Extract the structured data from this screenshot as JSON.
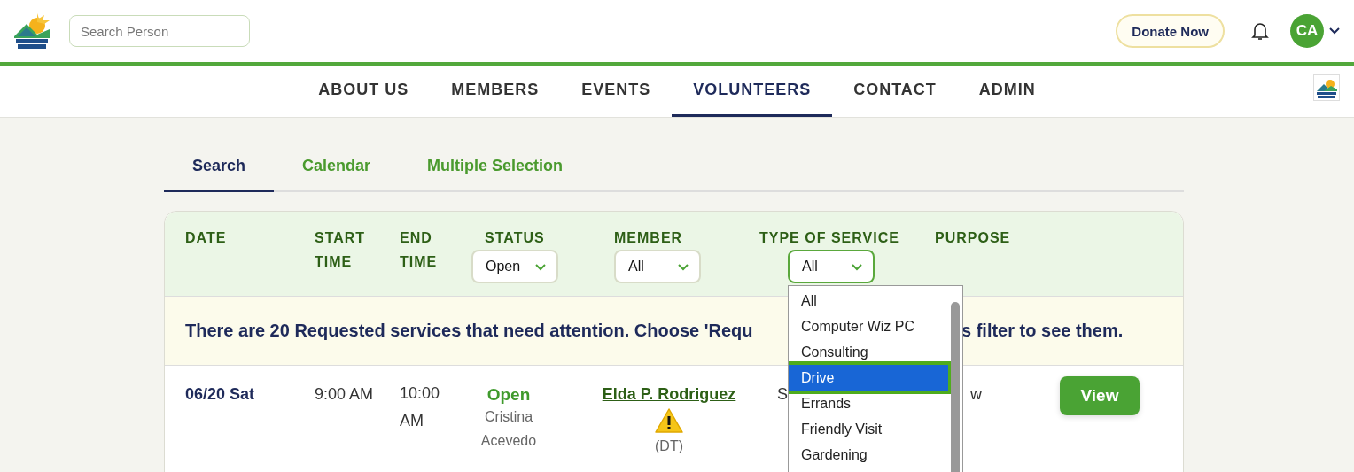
{
  "header": {
    "search": {
      "placeholder": "Search Person"
    },
    "donate": "Donate Now",
    "avatar": "CA"
  },
  "nav": [
    {
      "label": "ABOUT US",
      "selected": false
    },
    {
      "label": "MEMBERS",
      "selected": false
    },
    {
      "label": "EVENTS",
      "selected": false
    },
    {
      "label": "VOLUNTEERS",
      "selected": true
    },
    {
      "label": "CONTACT",
      "selected": false
    },
    {
      "label": "ADMIN",
      "selected": false
    }
  ],
  "tabs": [
    {
      "label": "Search",
      "selected": true
    },
    {
      "label": "Calendar",
      "selected": false
    },
    {
      "label": "Multiple Selection",
      "selected": false
    }
  ],
  "filters": {
    "columns": [
      {
        "label": "DATE"
      },
      {
        "label": "START TIME"
      },
      {
        "label": "END TIME"
      },
      {
        "label": "STATUS",
        "select": "Open"
      },
      {
        "label": "MEMBER",
        "select": "All"
      },
      {
        "label": "TYPE OF SERVICE",
        "select": "All",
        "open": true
      },
      {
        "label": "PURPOSE"
      }
    ],
    "dropdown": [
      {
        "label": "All",
        "selected": false
      },
      {
        "label": "Computer Wiz PC",
        "selected": false
      },
      {
        "label": "Consulting",
        "selected": false
      },
      {
        "label": "Drive",
        "selected": true
      },
      {
        "label": "Errands",
        "selected": false
      },
      {
        "label": "Friendly Visit",
        "selected": false
      },
      {
        "label": "Gardening",
        "selected": false
      }
    ]
  },
  "banner": {
    "before": "There are 20 Requested services that need attention. Choose 'Requ",
    "after": "s filter to see them."
  },
  "rows": [
    {
      "date": "06/20 Sat",
      "start": "9:00 AM",
      "end": "10:00 AM",
      "status": "Open",
      "volunteer": "Cristina Acevedo",
      "member": "Elda P. Rodriguez",
      "warning": true,
      "member_note": "(DT)",
      "service": "S",
      "purpose": "w",
      "action": "View"
    }
  ]
}
